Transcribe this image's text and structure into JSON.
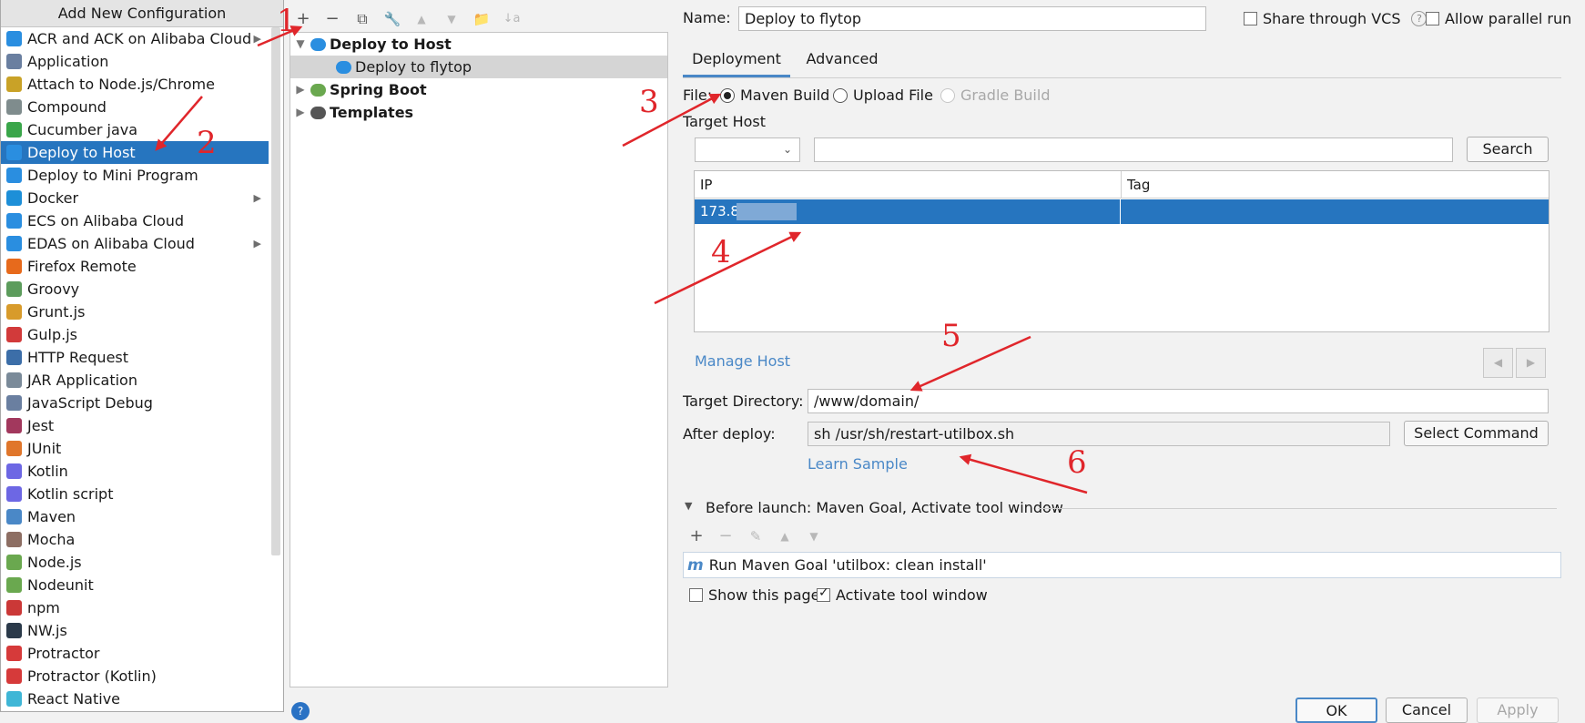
{
  "popup": {
    "title": "Add New Configuration",
    "items": [
      {
        "label": "ACR and ACK on Alibaba Cloud",
        "icon": "cloud-icon",
        "color": "#2a8ee0",
        "submenu": true
      },
      {
        "label": "Application",
        "icon": "application-icon",
        "color": "#6a7fa0",
        "submenu": false
      },
      {
        "label": "Attach to Node.js/Chrome",
        "icon": "nodejs-attach-icon",
        "color": "#c9a227",
        "submenu": false
      },
      {
        "label": "Compound",
        "icon": "compound-icon",
        "color": "#7f8c8d",
        "submenu": false
      },
      {
        "label": "Cucumber java",
        "icon": "cucumber-icon",
        "color": "#3aa64a",
        "submenu": false
      },
      {
        "label": "Deploy to Host",
        "icon": "cloud-icon",
        "color": "#2a8ee0",
        "submenu": false,
        "selected": true
      },
      {
        "label": "Deploy to Mini Program",
        "icon": "cloud-icon",
        "color": "#2a8ee0",
        "submenu": false
      },
      {
        "label": "Docker",
        "icon": "docker-icon",
        "color": "#1d8fd8",
        "submenu": true
      },
      {
        "label": "ECS on Alibaba Cloud",
        "icon": "cloud-icon",
        "color": "#2a8ee0",
        "submenu": false
      },
      {
        "label": "EDAS on Alibaba Cloud",
        "icon": "cloud-icon",
        "color": "#2a8ee0",
        "submenu": true
      },
      {
        "label": "Firefox Remote",
        "icon": "firefox-icon",
        "color": "#e76a1c",
        "submenu": false
      },
      {
        "label": "Groovy",
        "icon": "groovy-icon",
        "color": "#5c9c5c",
        "submenu": false
      },
      {
        "label": "Grunt.js",
        "icon": "grunt-icon",
        "color": "#d89b2b",
        "submenu": false
      },
      {
        "label": "Gulp.js",
        "icon": "gulp-icon",
        "color": "#d23a3a",
        "submenu": false
      },
      {
        "label": "HTTP Request",
        "icon": "api-icon",
        "color": "#3c6ea8",
        "submenu": false
      },
      {
        "label": "JAR Application",
        "icon": "jar-icon",
        "color": "#7a8a99",
        "submenu": false
      },
      {
        "label": "JavaScript Debug",
        "icon": "js-debug-icon",
        "color": "#6a7fa0",
        "submenu": false
      },
      {
        "label": "Jest",
        "icon": "jest-icon",
        "color": "#a2385d",
        "submenu": false
      },
      {
        "label": "JUnit",
        "icon": "junit-icon",
        "color": "#e0762b",
        "submenu": false
      },
      {
        "label": "Kotlin",
        "icon": "kotlin-icon",
        "color": "#6d67e4",
        "submenu": false
      },
      {
        "label": "Kotlin script",
        "icon": "kotlin-icon",
        "color": "#6d67e4",
        "submenu": false
      },
      {
        "label": "Maven",
        "icon": "maven-icon",
        "color": "#4a88c7",
        "submenu": false
      },
      {
        "label": "Mocha",
        "icon": "mocha-icon",
        "color": "#8d6e63",
        "submenu": false
      },
      {
        "label": "Node.js",
        "icon": "nodejs-icon",
        "color": "#6aa84f",
        "submenu": false
      },
      {
        "label": "Nodeunit",
        "icon": "nodeunit-icon",
        "color": "#6aa84f",
        "submenu": false
      },
      {
        "label": "npm",
        "icon": "npm-icon",
        "color": "#cb3837",
        "submenu": false
      },
      {
        "label": "NW.js",
        "icon": "nwjs-icon",
        "color": "#2b3a4a",
        "submenu": false
      },
      {
        "label": "Protractor",
        "icon": "protractor-icon",
        "color": "#d63a3a",
        "submenu": false
      },
      {
        "label": "Protractor (Kotlin)",
        "icon": "protractor-icon",
        "color": "#d63a3a",
        "submenu": false
      },
      {
        "label": "React Native",
        "icon": "react-icon",
        "color": "#3fb6d6",
        "submenu": false
      }
    ]
  },
  "toolbar": {
    "add": "+",
    "remove": "−",
    "copy": "⧉",
    "edit": "🔧",
    "up": "▲",
    "down": "▼",
    "folder": "📁",
    "sort": "↓a"
  },
  "tree": {
    "rows": [
      {
        "label": "Deploy to Host",
        "toggle": "▼",
        "bold": true,
        "indent": 0,
        "icon": "cloud-icon"
      },
      {
        "label": "Deploy to flytop",
        "toggle": "",
        "bold": false,
        "indent": 1,
        "icon": "cloud-icon",
        "selected": true
      },
      {
        "label": "Spring Boot",
        "toggle": "▶",
        "bold": true,
        "indent": 0,
        "icon": "spring-boot-icon"
      },
      {
        "label": "Templates",
        "toggle": "▶",
        "bold": true,
        "indent": 0,
        "icon": "wrench-icon"
      }
    ]
  },
  "form": {
    "name_label": "Name:",
    "name_value": "Deploy to flytop",
    "share_label": "Share through VCS",
    "parallel_label": "Allow parallel run",
    "tabs": [
      "Deployment",
      "Advanced"
    ],
    "file_label": "File:",
    "file_options": [
      "Maven Build",
      "Upload File",
      "Gradle Build"
    ],
    "target_host_label": "Target Host",
    "search_button": "Search",
    "table_headers": [
      "IP",
      "Tag"
    ],
    "host_ip": "173.8",
    "manage_host": "Manage Host",
    "target_dir_label": "Target Directory:",
    "target_dir_value": "/www/domain/",
    "after_deploy_label": "After deploy:",
    "after_deploy_value": "sh /usr/sh/restart-utilbox.sh",
    "select_command": "Select Command",
    "learn_sample": "Learn Sample",
    "before_launch": "Before launch: Maven Goal, Activate tool window",
    "bl_item": "Run Maven Goal 'utilbox: clean install'",
    "show_page": "Show this page",
    "activate_window": "Activate tool window"
  },
  "footer": {
    "ok": "OK",
    "cancel": "Cancel",
    "apply": "Apply",
    "help": "?"
  },
  "annotations": [
    "1",
    "2",
    "3",
    "4",
    "5",
    "6"
  ],
  "colors": {
    "selection": "#2675bf",
    "accent": "#4a88c7",
    "annotation": "#e0262b"
  }
}
